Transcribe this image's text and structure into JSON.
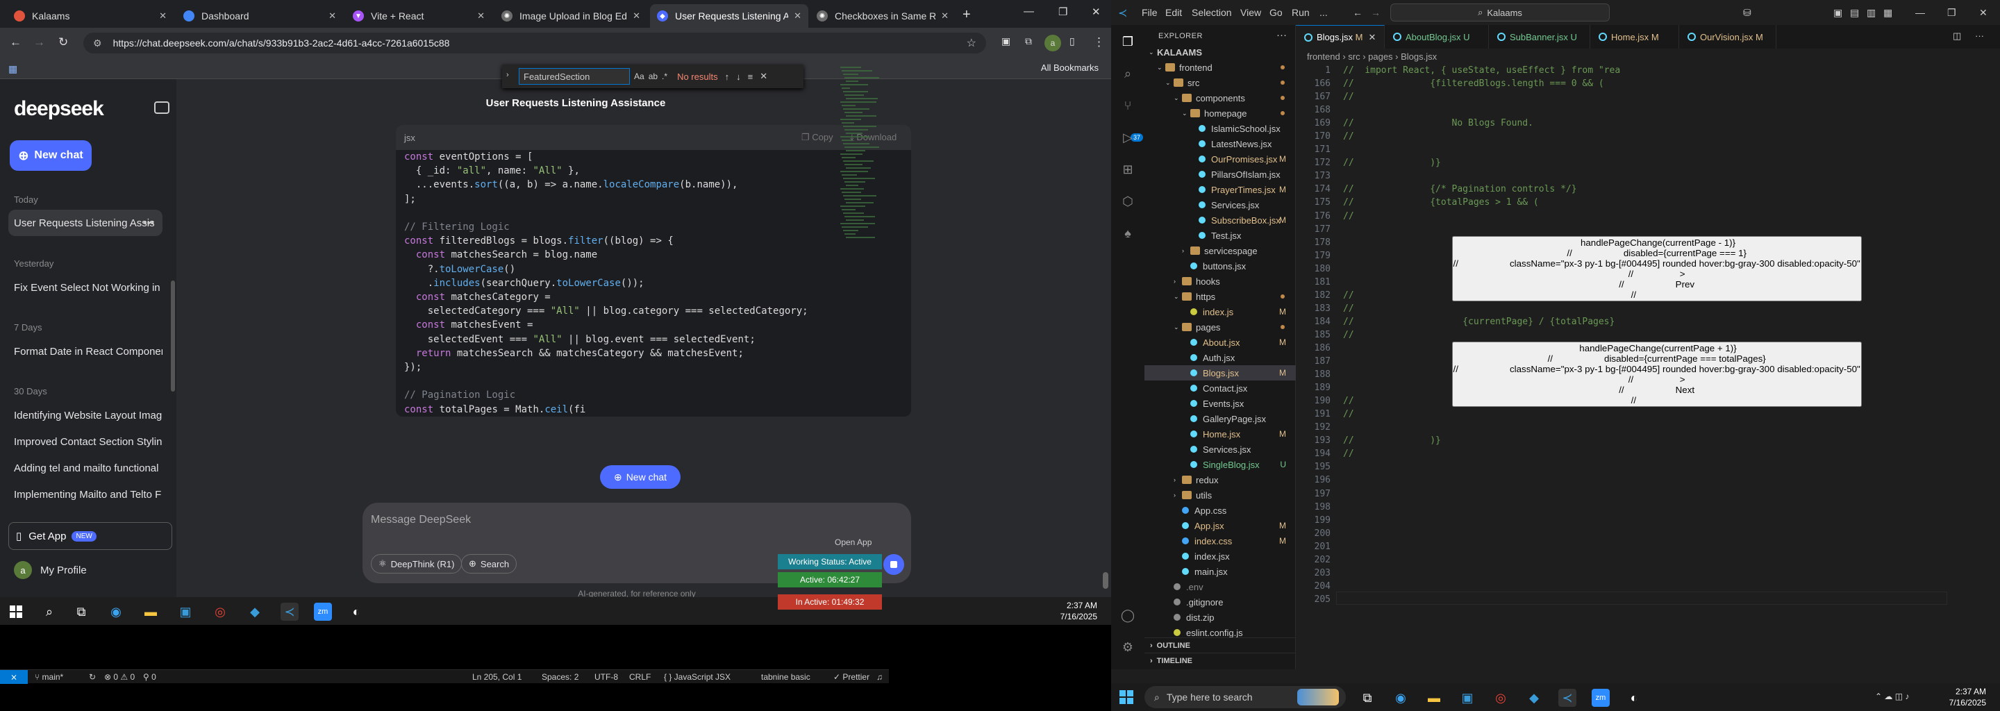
{
  "browser": {
    "tabs": [
      {
        "label": "Kalaams",
        "color": "#e0533d"
      },
      {
        "label": "Dashboard",
        "color": "#4285f4"
      },
      {
        "label": "Vite + React",
        "color": "#a855f7"
      },
      {
        "label": "Image Upload in Blog Editor",
        "color": "#d4d4d4"
      },
      {
        "label": "User Requests Listening Assis",
        "color": "#4d6bfe"
      },
      {
        "label": "Checkboxes in Same Row",
        "color": "#d4d4d4"
      }
    ],
    "url": "https://chat.deepseek.com/a/chat/s/933b91b3-2ac2-4d61-a4cc-7261a6015c88",
    "all_bookmarks": "All Bookmarks"
  },
  "deepseek": {
    "logo": "deepseek",
    "new_chat": "New chat",
    "groups": {
      "today": "Today",
      "yesterday": "Yesterday",
      "days7": "7 Days",
      "days30": "30 Days"
    },
    "history": {
      "today": [
        "User Requests Listening Assis"
      ],
      "yesterday": [
        "Fix Event Select Not Working in"
      ],
      "days7": [
        "Format Date in React Componer"
      ],
      "days30": [
        "Identifying Website Layout Imag",
        "Improved Contact Section Stylin",
        "Adding tel and mailto functional",
        "Implementing Mailto and Telto F"
      ]
    },
    "get_app": "Get App",
    "new_badge": "NEW",
    "profile_initial": "a",
    "profile": "My Profile",
    "chat_title": "User Requests Listening Assistance",
    "code_lang": "jsx",
    "copy": "Copy",
    "download": "Download",
    "new_chat_float": "New chat",
    "message_placeholder": "Message DeepSeek",
    "deepthink": "DeepThink (R1)",
    "search": "Search",
    "disclaimer": "AI-generated, for reference only"
  },
  "taskbar1": {
    "time": "2:37 AM",
    "date": "7/16/2025"
  },
  "vscode": {
    "menu": [
      "File",
      "Edit",
      "Selection",
      "View",
      "Go",
      "Run",
      "..."
    ],
    "search": "Kalaams",
    "explorer_title": "EXPLORER",
    "outline": "OUTLINE",
    "timeline": "TIMELINE",
    "tabs": [
      {
        "label": "Blogs.jsx",
        "status": "M"
      },
      {
        "label": "AboutBlog.jsx",
        "status": "U"
      },
      {
        "label": "SubBanner.jsx",
        "status": "U"
      },
      {
        "label": "Home.jsx",
        "status": "M"
      },
      {
        "label": "OurVision.jsx",
        "status": "M"
      }
    ],
    "breadcrumb": "frontend  ›  src  ›  pages  ›  Blogs.jsx",
    "find_value": "FeaturedSection",
    "find_result": "No results",
    "open_app": "Open App",
    "working_status": "Working Status: Active",
    "active_time": "Active: 06:42:27",
    "inactive_time": "In Active: 01:49:32",
    "status": {
      "branch": "main*",
      "problems": "⊗ 0  ⚠ 0",
      "ports": "0",
      "cursor": "Ln 205, Col 1",
      "spaces": "Spaces: 2",
      "encoding": "UTF-8",
      "eol": "CRLF",
      "language": "{ } JavaScript JSX",
      "tabnine": "tabnine basic",
      "prettier": "✓ Prettier"
    }
  },
  "taskbar2": {
    "search": "Type here to search",
    "time": "2:37 AM",
    "date": "7/16/2025"
  }
}
